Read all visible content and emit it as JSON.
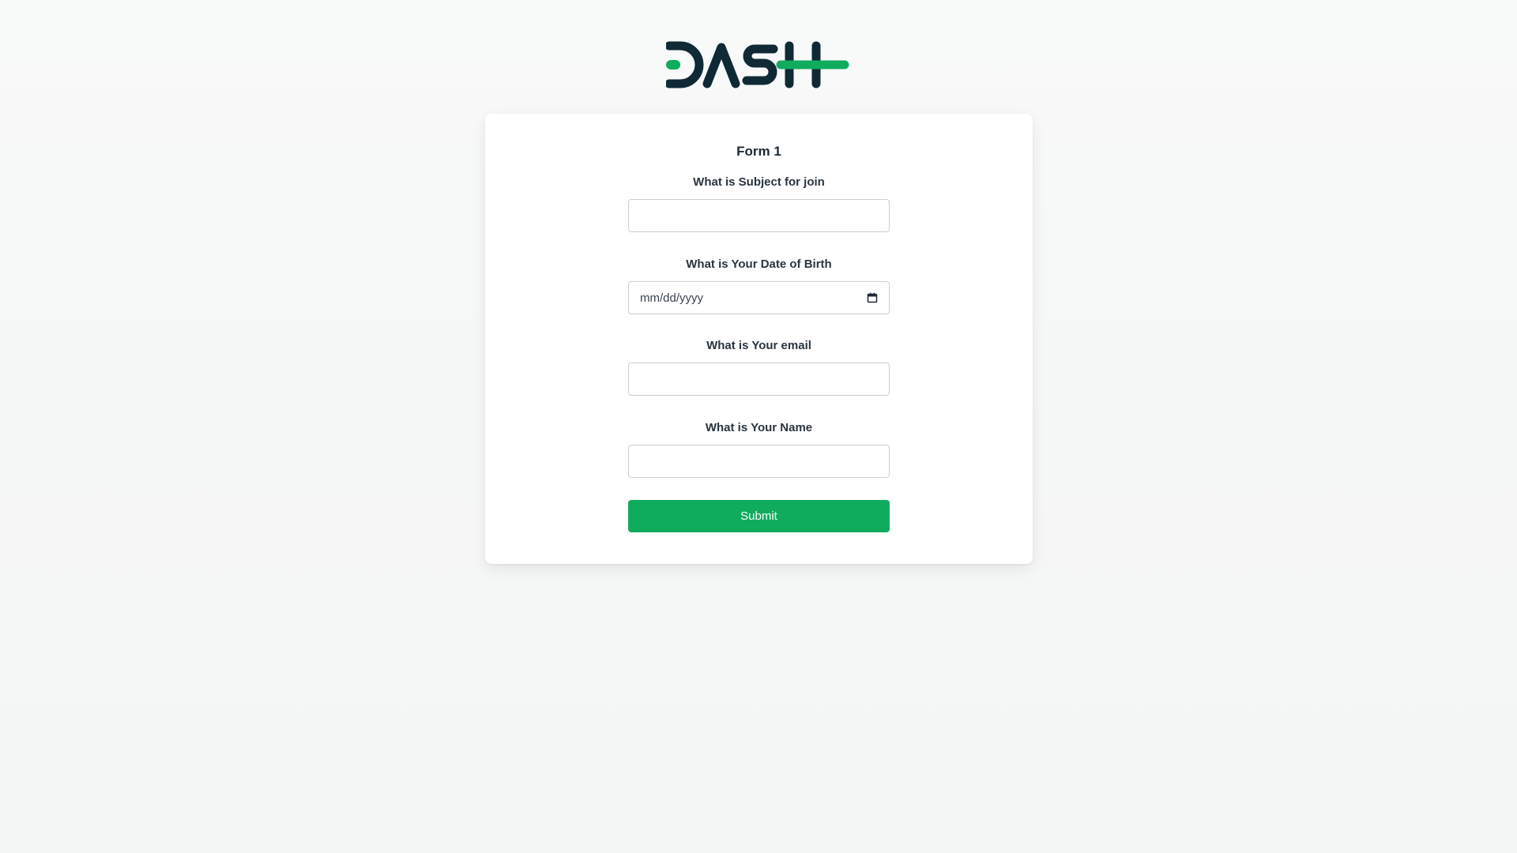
{
  "logo": {
    "name": "DASH logo",
    "colors": {
      "primary": "#0f2a35",
      "accent": "#10ac5e"
    }
  },
  "form": {
    "title": "Form 1",
    "fields": [
      {
        "label": "What is Subject for join",
        "value": "",
        "placeholder": ""
      },
      {
        "label": "What is Your Date of Birth",
        "value": "",
        "placeholder": "mm/dd/yyyy"
      },
      {
        "label": "What is Your email",
        "value": "",
        "placeholder": ""
      },
      {
        "label": "What is Your Name",
        "value": "",
        "placeholder": ""
      }
    ],
    "submit_label": "Submit"
  },
  "colors": {
    "accent": "#10ac5e",
    "background": "#f6f7f7",
    "card": "#ffffff"
  },
  "icons": {
    "date_picker": "calendar-icon"
  }
}
